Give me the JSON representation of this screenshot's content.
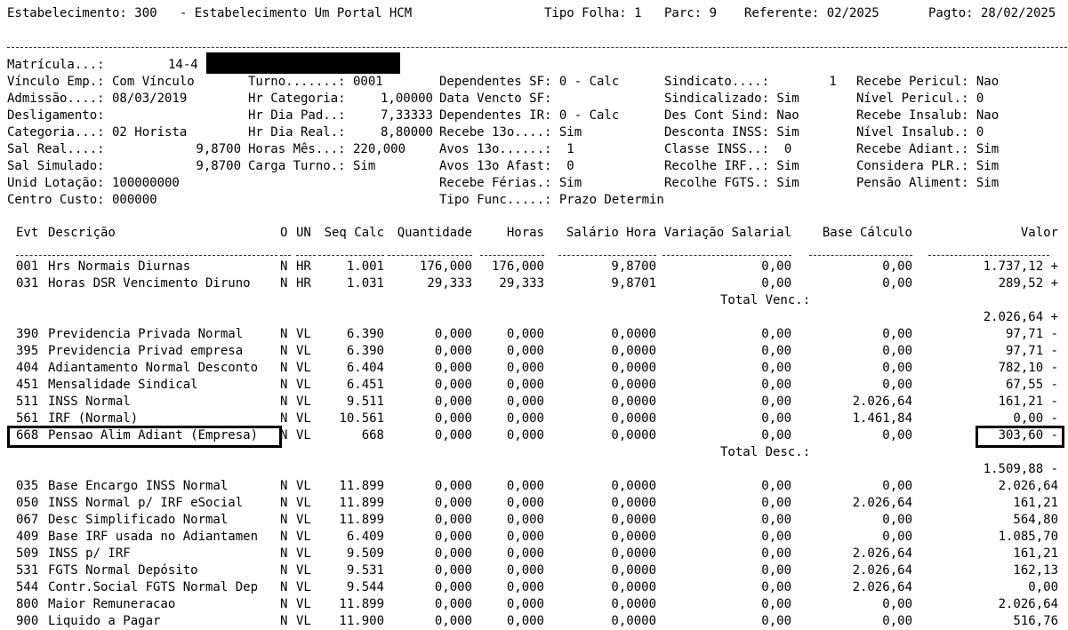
{
  "header": {
    "estab": "Estabelecimento: 300   - Estabelecimento Um Portal HCM",
    "tipo_folha": "Tipo Folha: 1",
    "parc": "Parc: 9",
    "referente": "Referente: 02/2025",
    "pagto": "Pagto: 28/02/2025"
  },
  "info": {
    "matricula_label": "Matrícula...:",
    "matricula_value": "14-4",
    "col1": [
      "Vínculo Emp.: Com Vínculo",
      "Admissão....: 08/03/2019",
      "Desligamento:",
      "Categoria...: 02 Horista",
      "Sal Real....:",
      "Sal Simulado:",
      "Unid Lotação: 100000000",
      "Centro Custo: 000000"
    ],
    "col1_vals": [
      "",
      "",
      "",
      "",
      "9,8700",
      "9,8700",
      "",
      ""
    ],
    "col2": [
      "Turno.......: 0001",
      "Hr Categoria:",
      "Hr Dia Pad..:",
      "Hr Dia Real.:",
      "Horas Mês...: 220,000",
      "Carga Turno.: Sim"
    ],
    "col2_vals": [
      "",
      "1,00000",
      "7,33333",
      "8,80000",
      "",
      ""
    ],
    "col3": [
      "Dependentes SF: 0 - Calc",
      "Data Vencto SF:",
      "Dependentes IR: 0 - Calc",
      "Recebe 13o....: Sim",
      "Avos 13o......:  1",
      "Avos 13o Afast:  0",
      "Recebe Férias.: Sim",
      "Tipo Func.....: Prazo Determin"
    ],
    "col4": [
      "Sindicato....:        1",
      "Sindicalizado: Sim",
      "Des Cont Sind: Nao",
      "Desconta INSS: Sim",
      "Classe INSS..:  0",
      "Recolhe IRF..: Sim",
      "Recolhe FGTS.: Sim"
    ],
    "col5": [
      "Recebe Pericul: Nao",
      "Nível Pericul.: 0",
      "Recebe Insalub: Nao",
      "Nível Insalub.: 0",
      "Recebe Adiant.: Sim",
      "Considera PLR.: Sim",
      "Pensão Aliment: Sim"
    ]
  },
  "table": {
    "headers": {
      "evt": "Evt",
      "desc": "Descrição",
      "o": "O",
      "un": "UN",
      "seq": "Seq Calc",
      "qtd": "Quantidade",
      "horas": "Horas",
      "sal": "Salário Hora",
      "var": "Variação Salarial",
      "base": "Base Cálculo",
      "valor": "Valor"
    },
    "rows": [
      {
        "evt": "001",
        "desc": "Hrs Normais Diurnas",
        "o": "N",
        "un": "HR",
        "seq": "1.001",
        "qtd": "176,000",
        "horas": "176,000",
        "sal": "9,8700",
        "var": "0,00",
        "base": "0,00",
        "valor": "1.737,12 +"
      },
      {
        "evt": "031",
        "desc": "Horas DSR Vencimento Diruno",
        "o": "N",
        "un": "HR",
        "seq": "1.031",
        "qtd": "29,333",
        "horas": "29,333",
        "sal": "9,8701",
        "var": "0,00",
        "base": "0,00",
        "valor": "289,52 +"
      },
      {
        "total": true,
        "label": "Total Venc.:",
        "valor": ""
      },
      {
        "evt": "",
        "desc": "",
        "o": "",
        "un": "",
        "seq": "",
        "qtd": "",
        "horas": "",
        "sal": "",
        "var": "",
        "base": "",
        "valor": "2.026,64 +"
      },
      {
        "evt": "390",
        "desc": "Previdencia Privada Normal",
        "o": "N",
        "un": "VL",
        "seq": "6.390",
        "qtd": "0,000",
        "horas": "0,000",
        "sal": "0,0000",
        "var": "0,00",
        "base": "0,00",
        "valor": "97,71 -"
      },
      {
        "evt": "395",
        "desc": "Previdencia Privad empresa",
        "o": "N",
        "un": "VL",
        "seq": "6.390",
        "qtd": "0,000",
        "horas": "0,000",
        "sal": "0,0000",
        "var": "0,00",
        "base": "0,00",
        "valor": "97,71 -"
      },
      {
        "evt": "404",
        "desc": "Adiantamento Normal Desconto",
        "o": "N",
        "un": "VL",
        "seq": "6.404",
        "qtd": "0,000",
        "horas": "0,000",
        "sal": "0,0000",
        "var": "0,00",
        "base": "0,00",
        "valor": "782,10 -"
      },
      {
        "evt": "451",
        "desc": "Mensalidade Sindical",
        "o": "N",
        "un": "VL",
        "seq": "6.451",
        "qtd": "0,000",
        "horas": "0,000",
        "sal": "0,0000",
        "var": "0,00",
        "base": "0,00",
        "valor": "67,55 -"
      },
      {
        "evt": "511",
        "desc": "INSS Normal",
        "o": "N",
        "un": "VL",
        "seq": "9.511",
        "qtd": "0,000",
        "horas": "0,000",
        "sal": "0,0000",
        "var": "0,00",
        "base": "2.026,64",
        "valor": "161,21 -"
      },
      {
        "evt": "561",
        "desc": "IRF (Normal)",
        "o": "N",
        "un": "VL",
        "seq": "10.561",
        "qtd": "0,000",
        "horas": "0,000",
        "sal": "0,0000",
        "var": "0,00",
        "base": "1.461,84",
        "valor": "0,00 -"
      },
      {
        "evt": "668",
        "desc": "Pensao Alim Adiant (Empresa)",
        "o": "N",
        "un": "VL",
        "seq": "668",
        "qtd": "0,000",
        "horas": "0,000",
        "sal": "0,0000",
        "var": "0,00",
        "base": "0,00",
        "valor": "303,60 -"
      },
      {
        "total": true,
        "label": "Total Desc.:",
        "valor": ""
      },
      {
        "evt": "",
        "desc": "",
        "o": "",
        "un": "",
        "seq": "",
        "qtd": "",
        "horas": "",
        "sal": "",
        "var": "",
        "base": "",
        "valor": "1.509,88 -"
      },
      {
        "evt": "035",
        "desc": "Base Encargo INSS Normal",
        "o": "N",
        "un": "VL",
        "seq": "11.899",
        "qtd": "0,000",
        "horas": "0,000",
        "sal": "0,0000",
        "var": "0,00",
        "base": "0,00",
        "valor": "2.026,64"
      },
      {
        "evt": "050",
        "desc": "INSS Normal p/ IRF eSocial",
        "o": "N",
        "un": "VL",
        "seq": "11.899",
        "qtd": "0,000",
        "horas": "0,000",
        "sal": "0,0000",
        "var": "0,00",
        "base": "2.026,64",
        "valor": "161,21"
      },
      {
        "evt": "067",
        "desc": "Desc Simplificado Normal",
        "o": "N",
        "un": "VL",
        "seq": "11.899",
        "qtd": "0,000",
        "horas": "0,000",
        "sal": "0,0000",
        "var": "0,00",
        "base": "0,00",
        "valor": "564,80"
      },
      {
        "evt": "409",
        "desc": "Base IRF usada no Adiantamen",
        "o": "N",
        "un": "VL",
        "seq": "6.409",
        "qtd": "0,000",
        "horas": "0,000",
        "sal": "0,0000",
        "var": "0,00",
        "base": "0,00",
        "valor": "1.085,70"
      },
      {
        "evt": "509",
        "desc": "INSS p/ IRF",
        "o": "N",
        "un": "VL",
        "seq": "9.509",
        "qtd": "0,000",
        "horas": "0,000",
        "sal": "0,0000",
        "var": "0,00",
        "base": "2.026,64",
        "valor": "161,21"
      },
      {
        "evt": "531",
        "desc": "FGTS Normal Depósito",
        "o": "N",
        "un": "VL",
        "seq": "9.531",
        "qtd": "0,000",
        "horas": "0,000",
        "sal": "0,0000",
        "var": "0,00",
        "base": "2.026,64",
        "valor": "162,13"
      },
      {
        "evt": "544",
        "desc": "Contr.Social FGTS Normal Dep",
        "o": "N",
        "un": "VL",
        "seq": "9.544",
        "qtd": "0,000",
        "horas": "0,000",
        "sal": "0,0000",
        "var": "0,00",
        "base": "2.026,64",
        "valor": "0,00"
      },
      {
        "evt": "800",
        "desc": "Maior Remuneracao",
        "o": "N",
        "un": "VL",
        "seq": "11.899",
        "qtd": "0,000",
        "horas": "0,000",
        "sal": "0,0000",
        "var": "0,00",
        "base": "0,00",
        "valor": "2.026,64"
      },
      {
        "evt": "900",
        "desc": "Liquido a Pagar",
        "o": "N",
        "un": "VL",
        "seq": "11.900",
        "qtd": "0,000",
        "horas": "0,000",
        "sal": "0,0000",
        "var": "0,00",
        "base": "0,00",
        "valor": "516,76"
      }
    ]
  }
}
